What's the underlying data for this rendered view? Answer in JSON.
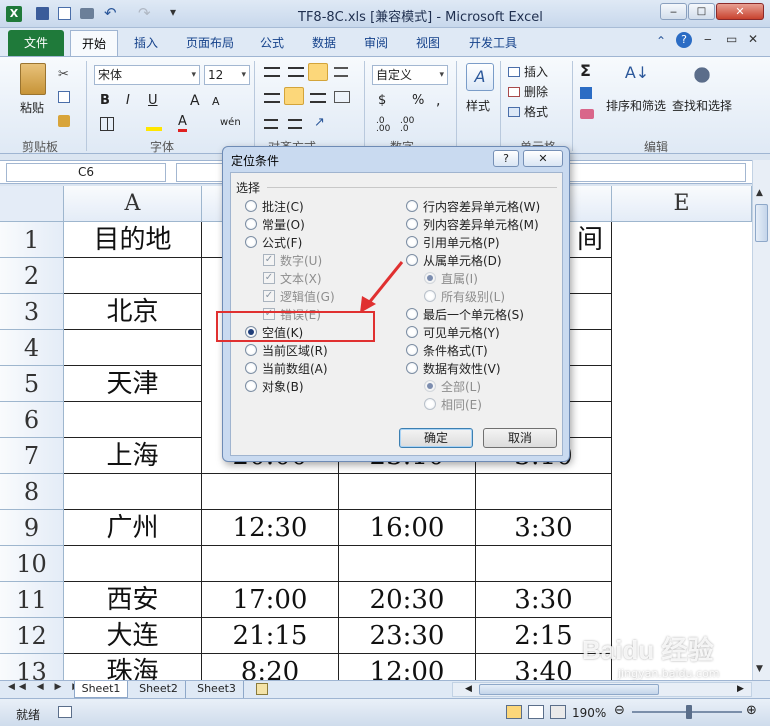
{
  "window": {
    "title": "TF8-8C.xls  [兼容模式]  -  Microsoft Excel"
  },
  "ribbon_tabs": [
    "文件",
    "开始",
    "插入",
    "页面布局",
    "公式",
    "数据",
    "审阅",
    "视图",
    "开发工具"
  ],
  "ribbon": {
    "paste": "粘贴",
    "clipboard_group": "剪贴板",
    "font_name": "宋体",
    "font_size": "12",
    "font_group": "字体",
    "align_group": "对齐方式",
    "number_format": "自定义",
    "number_group": "数字",
    "styles": "样式",
    "cells_insert": "插入",
    "cells_delete": "删除",
    "cells_format": "格式",
    "cells_group": "单元格",
    "sort_filter": "排序和筛选",
    "find_select": "查找和选择",
    "edit_group": "编辑",
    "bold": "B",
    "italic": "I",
    "underline": "U",
    "currency": "$",
    "percent": "%",
    "font_a": "A",
    "wen": "wén"
  },
  "name_box": "C6",
  "columns": [
    "A",
    "E"
  ],
  "rows": [
    "1",
    "2",
    "3",
    "4",
    "5",
    "6",
    "7",
    "8",
    "9",
    "10",
    "11",
    "12",
    "13"
  ],
  "cells": {
    "a1": "目的地",
    "e1": "间",
    "a3": "北京",
    "a5": "天津",
    "a7": "上海",
    "b7": "20:00",
    "c7": "23:10",
    "d7": "3:10",
    "a9": "广州",
    "b9": "12:30",
    "c9": "16:00",
    "d9": "3:30",
    "a11": "西安",
    "b11": "17:00",
    "c11": "20:30",
    "d11": "3:30",
    "a12": "大连",
    "b12": "21:15",
    "c12": "23:30",
    "d12": "2:15",
    "a13": "珠海",
    "b13": "8:20",
    "c13": "12:00",
    "d13": "3:40"
  },
  "sheets": [
    "Sheet1",
    "Sheet2",
    "Sheet3"
  ],
  "status": {
    "ready": "就绪",
    "zoom": "190%"
  },
  "dialog": {
    "title": "定位条件",
    "help": "?",
    "close": "✕",
    "section": "选择",
    "left_options": [
      "批注(C)",
      "常量(O)",
      "公式(F)",
      "数字(U)",
      "文本(X)",
      "逻辑值(G)",
      "错误(E)",
      "空值(K)",
      "当前区域(R)",
      "当前数组(A)",
      "对象(B)"
    ],
    "right_options": [
      "行内容差异单元格(W)",
      "列内容差异单元格(M)",
      "引用单元格(P)",
      "从属单元格(D)",
      "直属(I)",
      "所有级别(L)",
      "最后一个单元格(S)",
      "可见单元格(Y)",
      "条件格式(T)",
      "数据有效性(V)",
      "全部(L)",
      "相同(E)"
    ],
    "ok": "确定",
    "cancel": "取消"
  },
  "watermark": "Baidu 经验",
  "watermark_url": "jingyan.baidu.com",
  "colors": {
    "accent": "#2b579a",
    "file_tab": "#1f7a3a",
    "annotation": "#e03030"
  }
}
